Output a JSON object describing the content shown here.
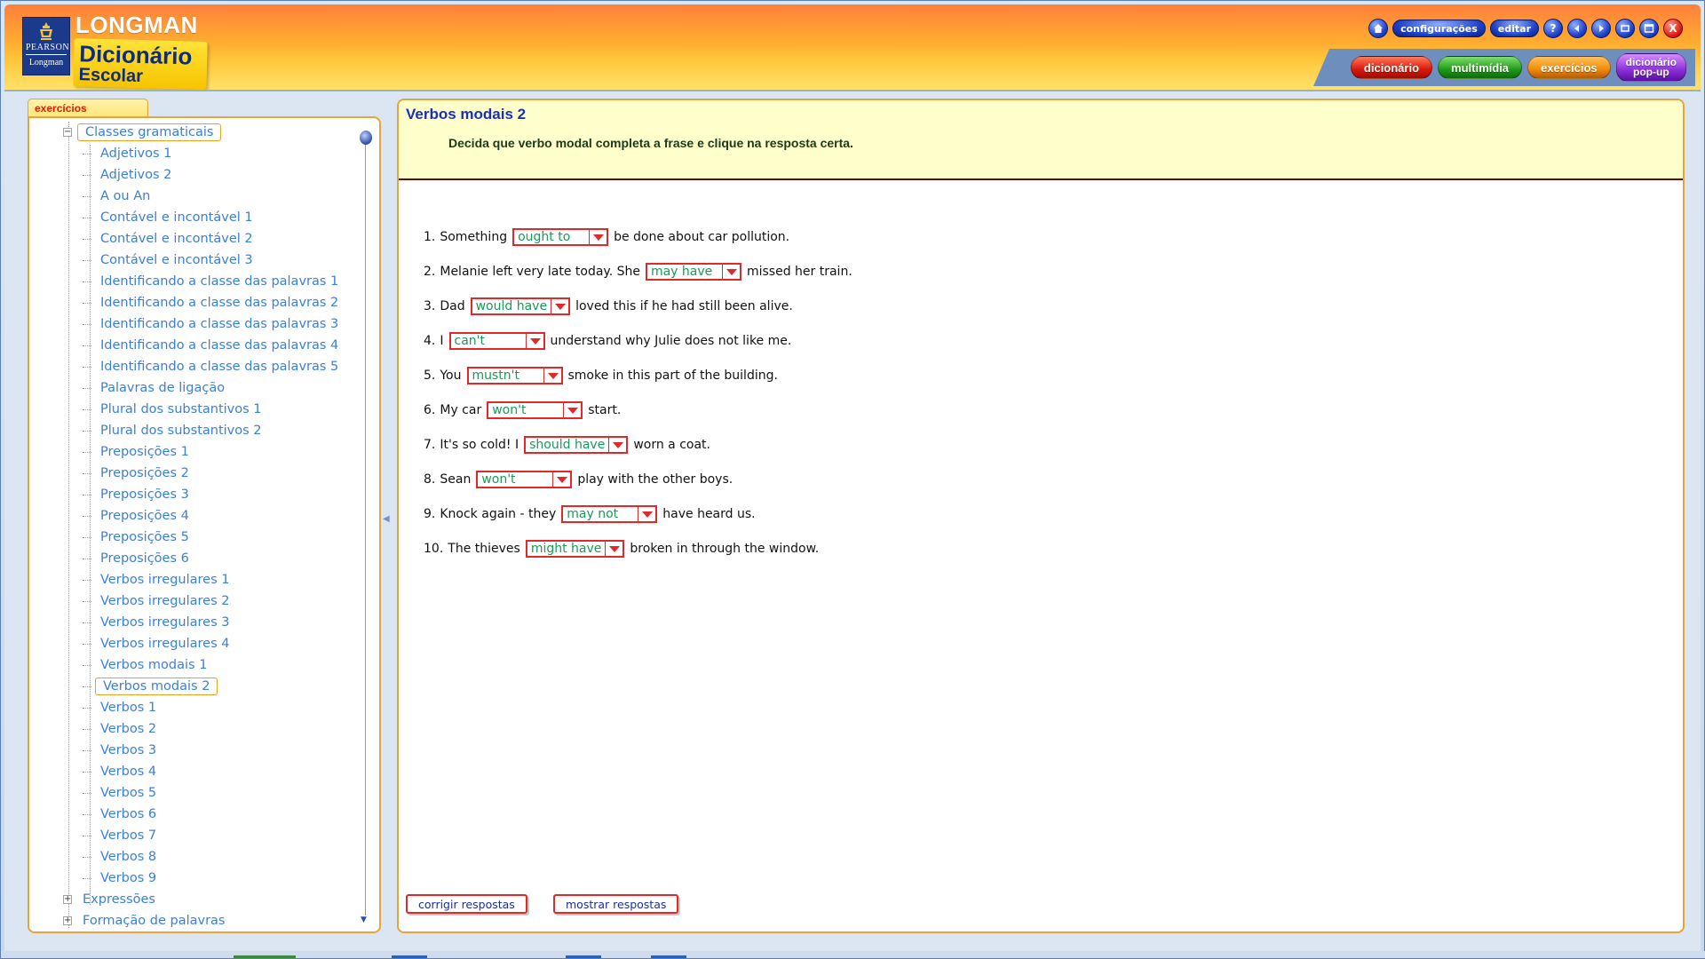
{
  "header": {
    "brand_top": "LONGMAN",
    "brand_main": "Dicionário",
    "brand_sub": "Escolar",
    "publisher": "PEARSON",
    "publisher_sub": "Longman",
    "top_buttons": {
      "home_icon": "home-icon",
      "settings": "configurações",
      "edit": "editar",
      "help": "?",
      "close": "X"
    },
    "tabs": {
      "dictionary": "dicionário",
      "multimedia": "multimídia",
      "exercises": "exercícios",
      "popup_line1": "dicionário",
      "popup_line2": "pop-up"
    }
  },
  "sidebar": {
    "tab_label": "exercícios",
    "root_group": "Classes gramaticais",
    "items": [
      "Adjetivos 1",
      "Adjetivos 2",
      "A ou An",
      "Contável e incontável 1",
      "Contável e incontável 2",
      "Contável e incontável 3",
      "Identificando a classe das palavras 1",
      "Identificando a classe das palavras 2",
      "Identificando a classe das palavras 3",
      "Identificando a classe das palavras 4",
      "Identificando a classe das palavras 5",
      "Palavras de ligação",
      "Plural dos substantivos 1",
      "Plural dos substantivos 2",
      "Preposições 1",
      "Preposições 2",
      "Preposições 3",
      "Preposições 4",
      "Preposições 5",
      "Preposições 6",
      "Verbos irregulares 1",
      "Verbos irregulares 2",
      "Verbos irregulares 3",
      "Verbos irregulares 4",
      "Verbos modais 1",
      "Verbos modais 2",
      "Verbos 1",
      "Verbos 2",
      "Verbos 3",
      "Verbos 4",
      "Verbos 5",
      "Verbos 6",
      "Verbos 7",
      "Verbos 8",
      "Verbos 9"
    ],
    "selected_item": "Verbos modais 2",
    "other_groups": [
      "Expressões",
      "Formação de palavras"
    ]
  },
  "exercise": {
    "title": "Verbos modais 2",
    "instruction": "Decida que verbo modal completa a frase e clique na resposta certa.",
    "questions": [
      {
        "num": "1.",
        "before": "Something",
        "answer": "ought to",
        "after": "be done about car pollution."
      },
      {
        "num": "2.",
        "before": "Melanie left very late today. She",
        "answer": "may have",
        "after": "missed her train."
      },
      {
        "num": "3.",
        "before": "Dad",
        "answer": "would have",
        "after": "loved this if he had still been alive."
      },
      {
        "num": "4.",
        "before": "I",
        "answer": "can't",
        "after": "understand why Julie does not like me."
      },
      {
        "num": "5.",
        "before": "You",
        "answer": "mustn't",
        "after": "smoke in this part of the building."
      },
      {
        "num": "6.",
        "before": "My car",
        "answer": "won't",
        "after": "start."
      },
      {
        "num": "7.",
        "before": "It's so cold! I",
        "answer": "should have",
        "after": "worn a coat."
      },
      {
        "num": "8.",
        "before": "Sean",
        "answer": "won't",
        "after": "play with the other boys."
      },
      {
        "num": "9.",
        "before": "Knock again - they",
        "answer": "may not",
        "after": "have heard us."
      },
      {
        "num": "10.",
        "before": "The thieves",
        "answer": "might have",
        "after": "broken in through the window."
      }
    ],
    "buttons": {
      "check": "corrigir respostas",
      "show": "mostrar respostas"
    }
  },
  "colors": {
    "accent_red": "#e02a2a",
    "answer_green": "#1a9a5a",
    "title_blue": "#1a2fc0",
    "tree_blue": "#3a7fd8",
    "panel_border": "#e8a33a"
  }
}
